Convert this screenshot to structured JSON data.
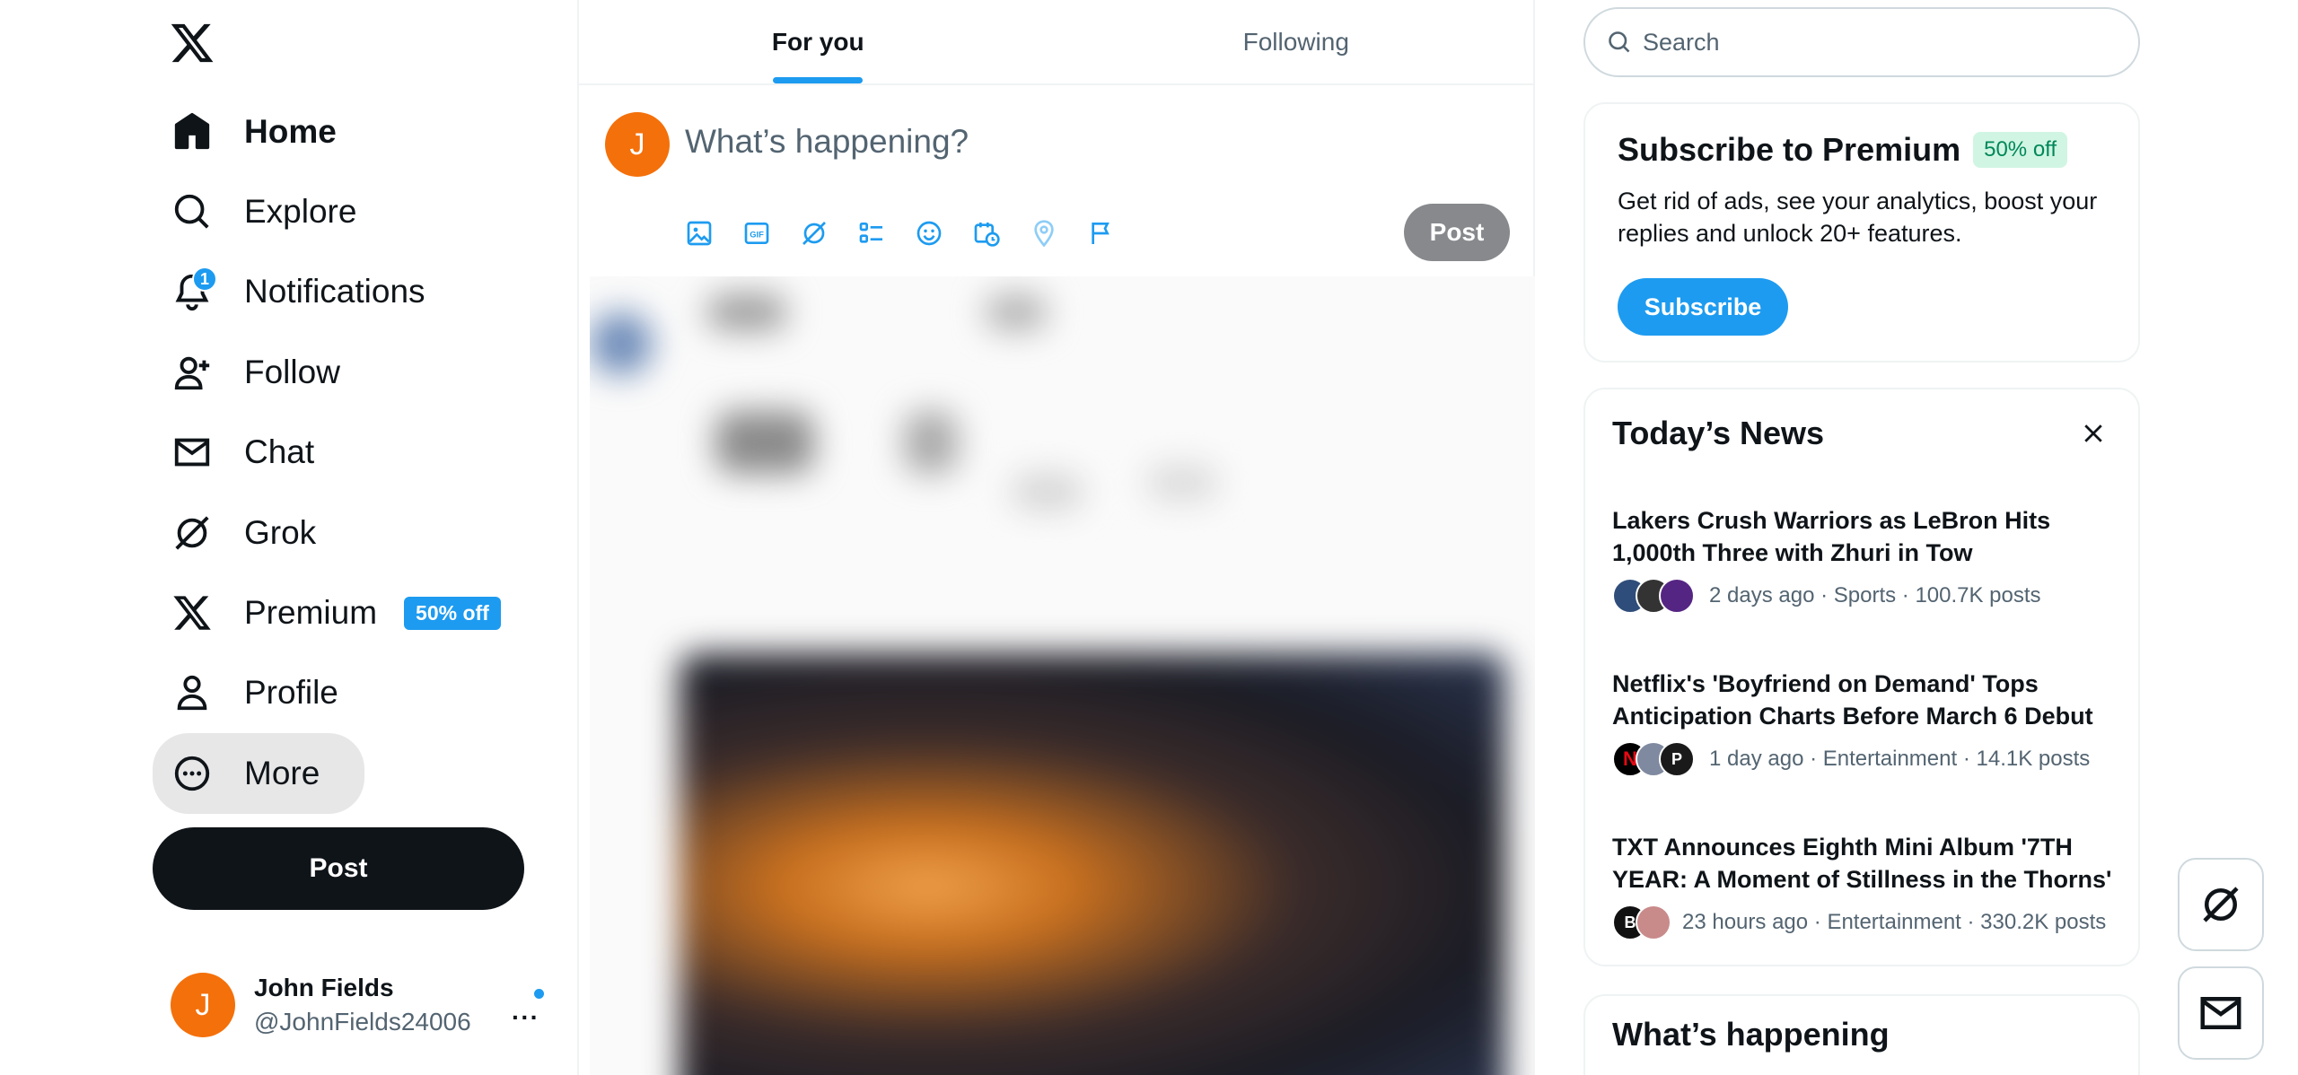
{
  "nav": {
    "items": [
      {
        "label": "Home",
        "icon": "home-icon"
      },
      {
        "label": "Explore",
        "icon": "search-icon"
      },
      {
        "label": "Notifications",
        "icon": "bell-icon",
        "badge": "1"
      },
      {
        "label": "Follow",
        "icon": "person-plus-icon"
      },
      {
        "label": "Chat",
        "icon": "envelope-icon"
      },
      {
        "label": "Grok",
        "icon": "grok-icon"
      },
      {
        "label": "Premium",
        "icon": "x-logo-icon",
        "badge": "50% off"
      },
      {
        "label": "Profile",
        "icon": "person-icon"
      },
      {
        "label": "More",
        "icon": "more-circle-icon"
      }
    ],
    "post_label": "Post"
  },
  "account": {
    "avatar_letter": "J",
    "name": "John Fields",
    "handle": "@JohnFields24006",
    "more": "···"
  },
  "tabs": [
    {
      "label": "For you",
      "active": true
    },
    {
      "label": "Following",
      "active": false
    }
  ],
  "composer": {
    "avatar_letter": "J",
    "placeholder": "What’s happening?",
    "tools": [
      "image-icon",
      "gif-icon",
      "grok-icon",
      "poll-icon",
      "emoji-icon",
      "schedule-icon",
      "location-icon",
      "flag-icon"
    ],
    "post_label": "Post"
  },
  "search": {
    "placeholder": "Search"
  },
  "premium": {
    "title": "Subscribe to Premium",
    "pill": "50% off",
    "description": "Get rid of ads, see your analytics, boost your replies and unlock 20+ features.",
    "button": "Subscribe"
  },
  "news": {
    "title": "Today’s News",
    "items": [
      {
        "headline": "Lakers Crush Warriors as LeBron Hits 1,000th Three with Zhuri in Tow",
        "meta": "2 days ago · Sports · 100.7K posts"
      },
      {
        "headline": "Netflix's 'Boyfriend on Demand' Tops Anticipation Charts Before March 6 Debut",
        "meta": "1 day ago · Entertainment · 14.1K posts"
      },
      {
        "headline": "TXT Announces Eighth Mini Album '7TH YEAR: A Moment of Stillness in the Thorns'",
        "meta": "23 hours ago · Entertainment · 330.2K posts"
      }
    ]
  },
  "happening": {
    "title": "What’s happening"
  },
  "colors": {
    "accent": "#1d9bf0",
    "avatar": "#f4700a",
    "text": "#0f1419",
    "muted": "#536471"
  }
}
